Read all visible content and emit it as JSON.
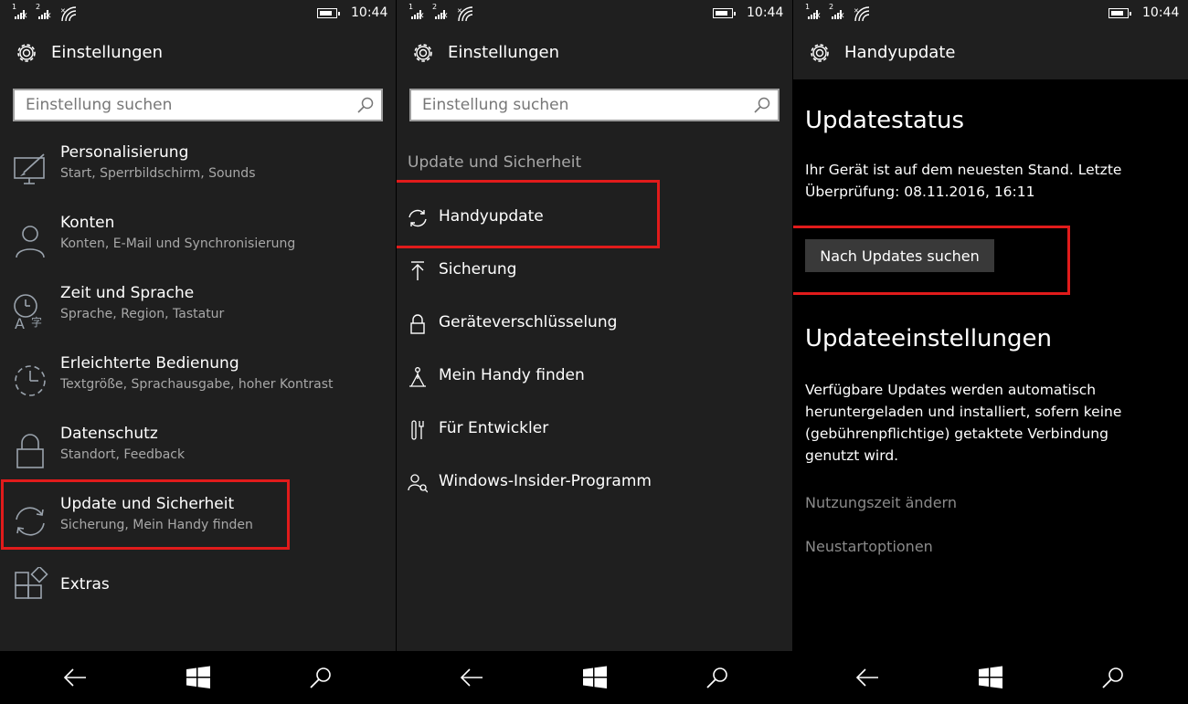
{
  "status": {
    "sim1": "1",
    "sim2": "2",
    "time": "10:44"
  },
  "screen1": {
    "title": "Einstellungen",
    "search_placeholder": "Einstellung suchen",
    "items": [
      {
        "icon": "personalization-icon",
        "title": "Personalisierung",
        "subtitle": "Start, Sperrbildschirm, Sounds"
      },
      {
        "icon": "person-icon",
        "title": "Konten",
        "subtitle": "Konten, E-Mail und Synchronisierung"
      },
      {
        "icon": "time-language-icon",
        "title": "Zeit und Sprache",
        "subtitle": "Sprache, Region, Tastatur"
      },
      {
        "icon": "ease-of-access-icon",
        "title": "Erleichterte Bedienung",
        "subtitle": "Textgröße, Sprachausgabe, hoher Kontrast"
      },
      {
        "icon": "lock-icon",
        "title": "Datenschutz",
        "subtitle": "Standort, Feedback"
      },
      {
        "icon": "sync-icon",
        "title": "Update und Sicherheit",
        "subtitle": "Sicherung, Mein Handy finden"
      },
      {
        "icon": "extras-icon",
        "title": "Extras",
        "subtitle": ""
      }
    ]
  },
  "screen2": {
    "title": "Einstellungen",
    "search_placeholder": "Einstellung suchen",
    "section_title": "Update und Sicherheit",
    "items": [
      {
        "icon": "sync-icon",
        "label": "Handyupdate"
      },
      {
        "icon": "backup-icon",
        "label": "Sicherung"
      },
      {
        "icon": "lock-icon",
        "label": "Geräteverschlüsselung"
      },
      {
        "icon": "find-phone-icon",
        "label": "Mein Handy finden"
      },
      {
        "icon": "developer-tools-icon",
        "label": "Für Entwickler"
      },
      {
        "icon": "insider-icon",
        "label": "Windows-Insider-Programm"
      }
    ]
  },
  "screen3": {
    "title": "Handyupdate",
    "update_status_heading": "Updatestatus",
    "update_status_text": "Ihr Gerät ist auf dem neuesten Stand. Letzte Überprüfung: 08.11.2016, 16:11",
    "check_button": "Nach Updates suchen",
    "update_settings_heading": "Updateeinstellungen",
    "update_settings_text": "Verfügbare Updates werden automatisch heruntergeladen und installiert, sofern keine (gebührenpflichtige) getaktete Verbindung genutzt wird.",
    "link_active_hours": "Nutzungszeit ändern",
    "link_restart_options": "Neustartoptionen"
  },
  "colors": {
    "background": "#1f1f1f",
    "highlight": "#e11b1b",
    "secondary_text": "#a8a8a8",
    "link_text": "#8a8a8a",
    "button": "#393939"
  }
}
